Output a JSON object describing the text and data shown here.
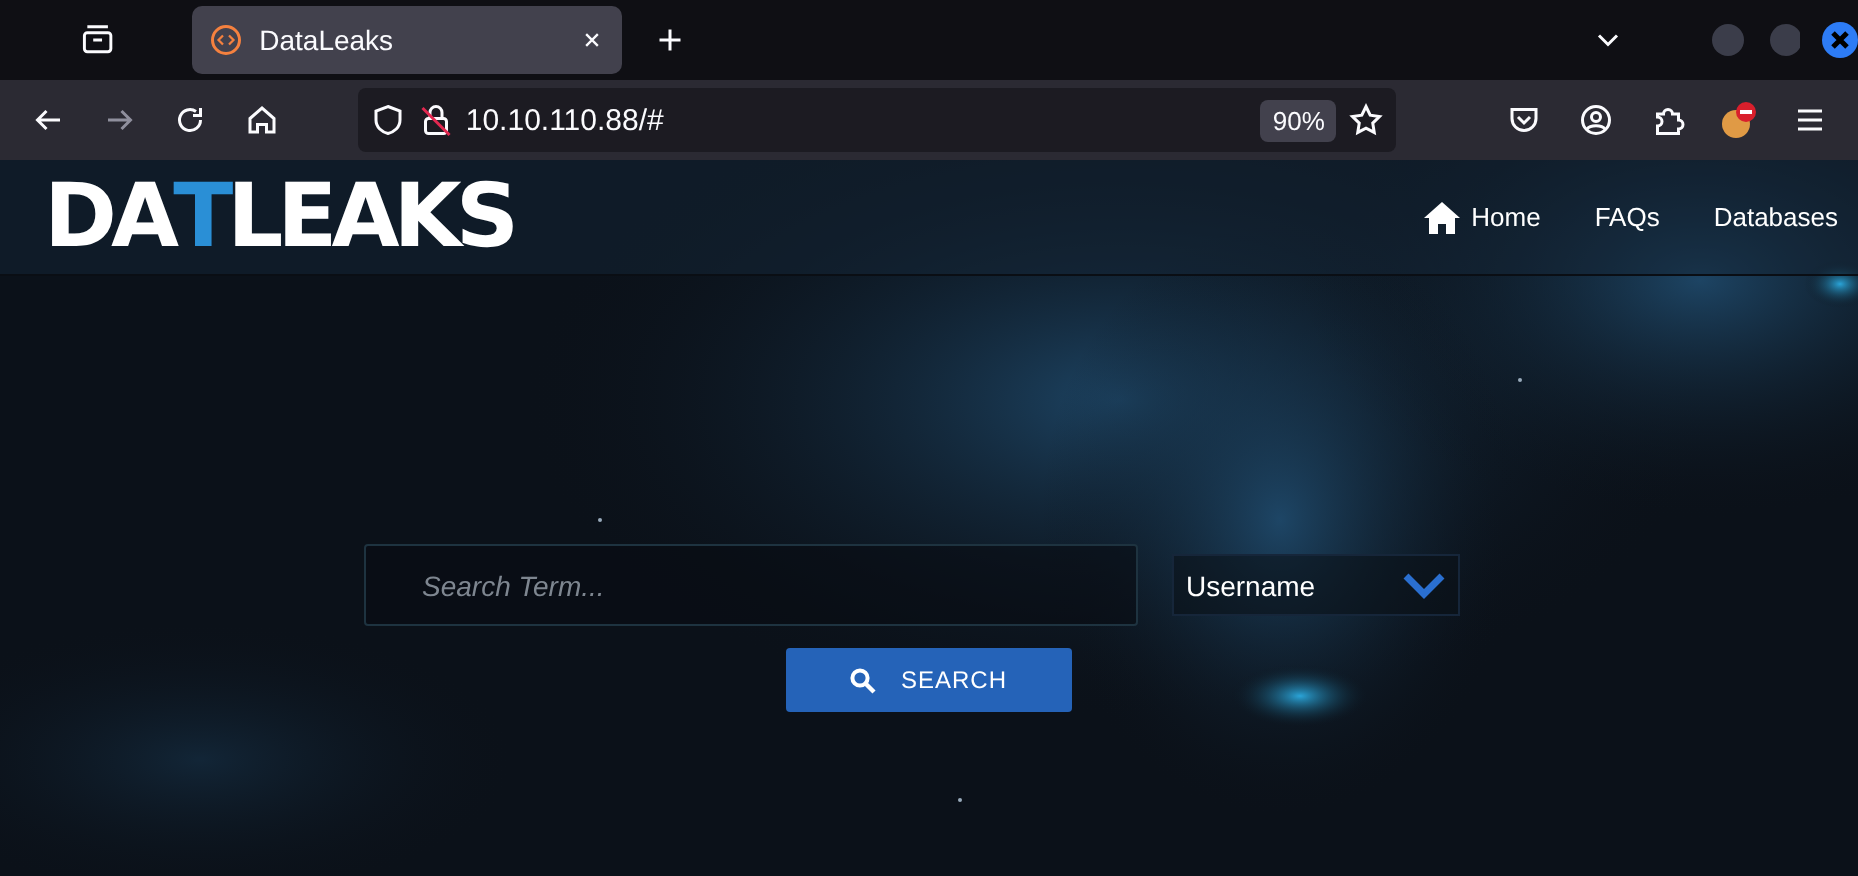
{
  "browser": {
    "tab": {
      "title": "DataLeaks",
      "selected": true
    },
    "address": "10.10.110.88/#",
    "zoom": "90%"
  },
  "logo": {
    "letters": [
      {
        "char": "D",
        "color": "#ffffff"
      },
      {
        "char": "A",
        "color": "#ffffff"
      },
      {
        "char": "T",
        "color": "#2a8fd6"
      },
      {
        "char": "L",
        "color": "#ffffff"
      },
      {
        "char": "E",
        "color": "#ffffff"
      },
      {
        "char": "A",
        "color": "#ffffff"
      },
      {
        "char": "K",
        "color": "#ffffff"
      },
      {
        "char": "S",
        "color": "#ffffff"
      }
    ]
  },
  "nav": [
    {
      "label": "Home",
      "kind": "home"
    },
    {
      "label": "FAQs",
      "kind": "plain"
    },
    {
      "label": "Databases",
      "kind": "plain"
    }
  ],
  "search": {
    "placeholder": "Search Term...",
    "type": "Username",
    "button": "SEARCH"
  }
}
